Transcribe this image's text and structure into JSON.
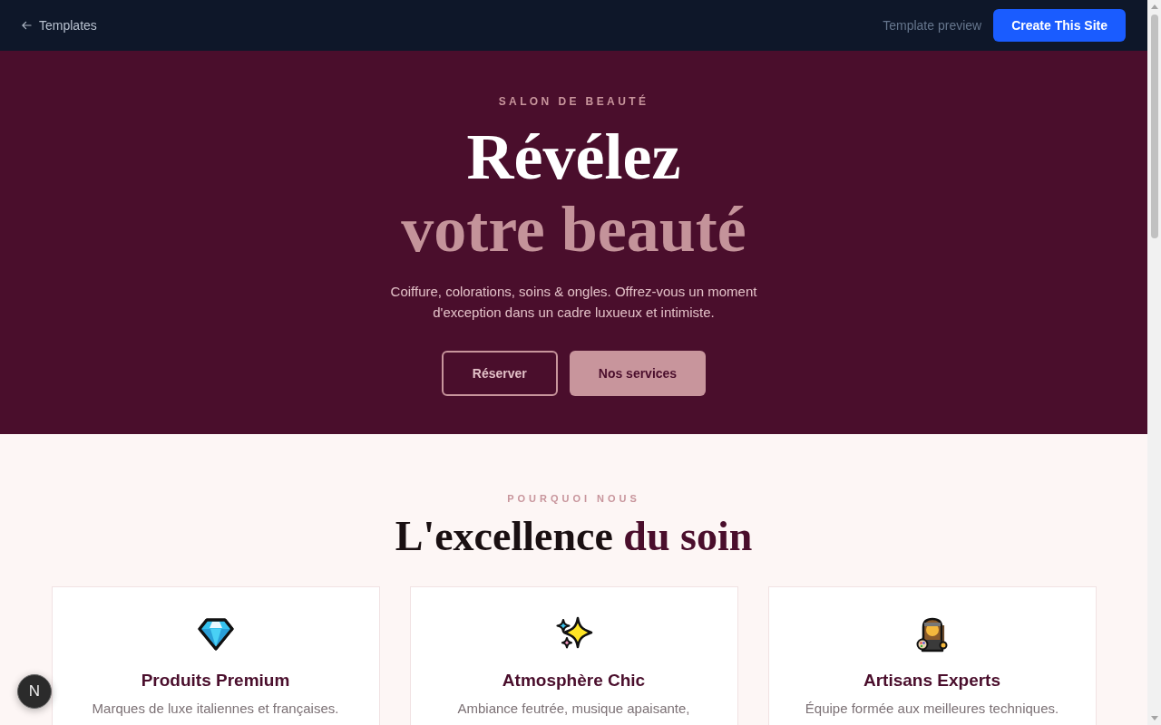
{
  "top_bar": {
    "back_link": {
      "label": "Templates"
    },
    "preview_label": "Template preview",
    "create_button": {
      "label": "Create This Site"
    }
  },
  "hero": {
    "eyebrow": "SALON DE BEAUTÉ",
    "title": {
      "line_1": "Révélez",
      "line_2": "votre beauté"
    },
    "description": "Coiffure, colorations, soins & ongles. Offrez-vous un moment d'exception dans un cadre luxueux et intimiste.",
    "buttons": [
      {
        "label": "Réserver",
        "kind": "outline"
      },
      {
        "label": "Nos services",
        "kind": "filled"
      }
    ]
  },
  "features": {
    "eyebrow": "POURQUOI NOUS",
    "title": {
      "text": "L'excellence",
      "accent": "du soin"
    },
    "cards": [
      {
        "title": "Produits Premium",
        "description": "Marques de luxe italiennes et françaises."
      },
      {
        "title": "Atmosphère Chic",
        "description": "Ambiance feutrée, musique apaisante,"
      },
      {
        "title": "Artisans Experts",
        "description": "Équipe formée aux meilleures techniques."
      }
    ]
  },
  "dev_badge": {
    "label": "N"
  }
}
